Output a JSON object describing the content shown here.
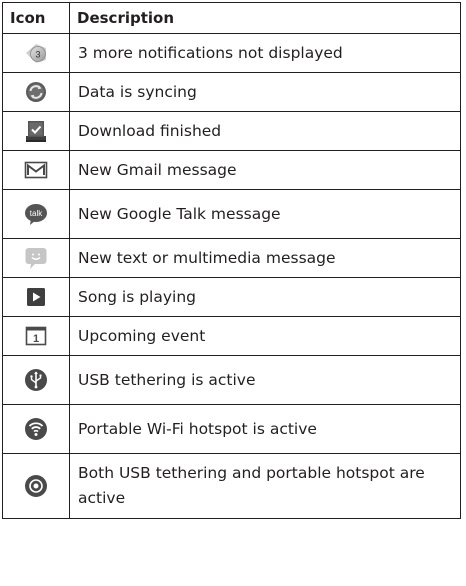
{
  "table": {
    "headers": {
      "icon": "Icon",
      "description": "Description"
    },
    "rows": [
      {
        "icon": "notifications-count-icon",
        "badge": "3",
        "description": "3 more notifications not displayed"
      },
      {
        "icon": "sync-icon",
        "description": "Data is syncing"
      },
      {
        "icon": "download-finished-icon",
        "description": "Download finished"
      },
      {
        "icon": "gmail-icon",
        "description": "New Gmail message"
      },
      {
        "icon": "google-talk-icon",
        "badge": "talk",
        "description": "New Google Talk message"
      },
      {
        "icon": "text-message-icon",
        "description": "New text or multimedia message"
      },
      {
        "icon": "play-icon",
        "description": "Song is playing"
      },
      {
        "icon": "calendar-icon",
        "badge": "1",
        "description": "Upcoming event"
      },
      {
        "icon": "usb-tethering-icon",
        "description": "USB tethering is active"
      },
      {
        "icon": "wifi-hotspot-icon",
        "description": "Portable Wi-Fi hotspot is active"
      },
      {
        "icon": "usb-and-hotspot-icon",
        "description": "Both USB tethering and portable hotspot are active"
      }
    ]
  },
  "colors": {
    "border": "#231f20",
    "text": "#231f20",
    "icon_dark": "#4a4a4a",
    "icon_light": "#bdbdbd"
  }
}
